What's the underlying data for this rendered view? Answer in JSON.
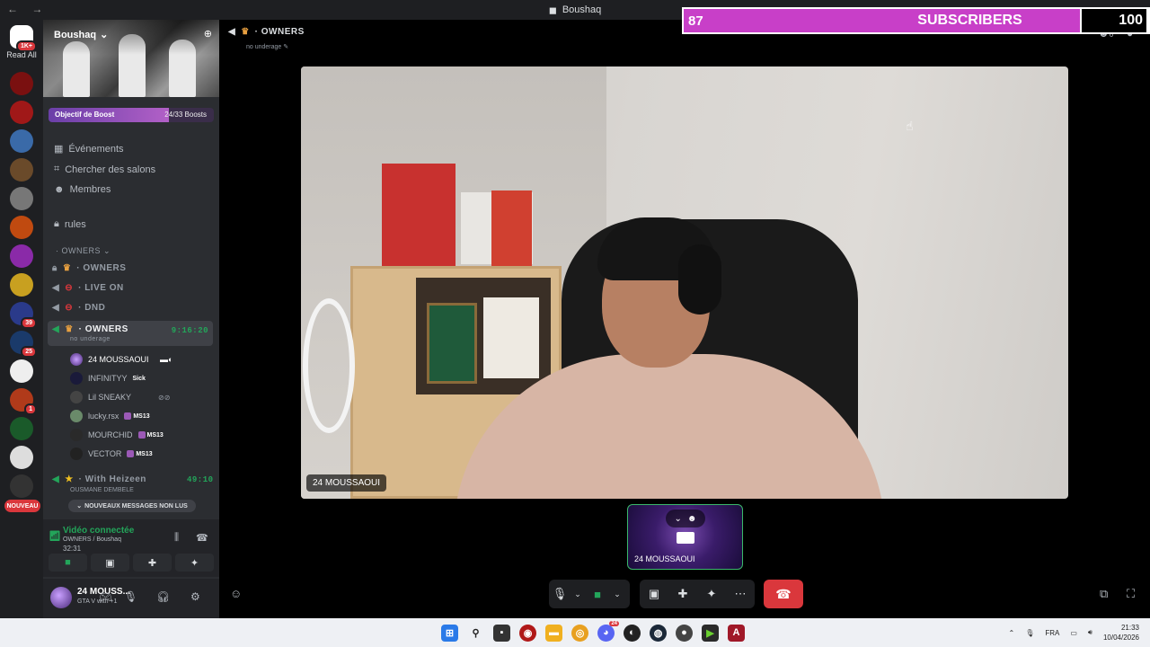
{
  "window": {
    "title": "Boushaq",
    "nav": "← →"
  },
  "overlay": {
    "current": "87",
    "label": "SUBSCRIBERS",
    "goal": "100",
    "progress": 0.87
  },
  "guilds": {
    "read_all": "Read All",
    "read_all_badge": "1K+",
    "new_badge": "NOUVEAU",
    "badges": [
      "39",
      "25",
      "1"
    ]
  },
  "server": {
    "name": "Boushaq",
    "boost": {
      "label": "Objectif de Boost",
      "count": "24/33 Boosts",
      "progress": 0.727
    },
    "nav": [
      "Événements",
      "Chercher des salons",
      "Membres"
    ],
    "text_channel": "rules",
    "category": "OWNERS",
    "voice_channels": [
      {
        "name": "OWNERS"
      },
      {
        "name": "LIVE ON"
      },
      {
        "name": "DND"
      }
    ],
    "active_channel": {
      "name": "OWNERS",
      "time": "9:16:20",
      "status": "no underage"
    },
    "members": [
      {
        "name": "24 MOUSSAOUI",
        "tag": ""
      },
      {
        "name": "INFINITYY",
        "tag": "Sick"
      },
      {
        "name": "Lil SNEAKY",
        "tag": ""
      },
      {
        "name": "lucky.rsx",
        "tag": "MS13"
      },
      {
        "name": "MOURCHID",
        "tag": "MS13"
      },
      {
        "name": "VECTOR",
        "tag": "MS13"
      }
    ],
    "other_channel": {
      "name": "With Heizeen",
      "time": "49:10",
      "sub": "OUSMANE DEMBELE"
    },
    "unread_pill": "NOUVEAUX MESSAGES NON LUS",
    "voice_panel": {
      "status": "Vidéo connectée",
      "where": "OWNERS / Boushaq",
      "time": "32:31"
    },
    "user": {
      "name": "24 MOUSS...",
      "activity": "GTA V with +1"
    }
  },
  "stage": {
    "header": "OWNERS",
    "header_sub": "no underage",
    "video_label": "24 MOUSSAOUI",
    "thumb_label": "24 MOUSSAOUI",
    "top_count": "6"
  },
  "taskbar": {
    "lang": "FRA",
    "time": "21:33",
    "date": "10/04/2026",
    "discord_badge": "24"
  }
}
